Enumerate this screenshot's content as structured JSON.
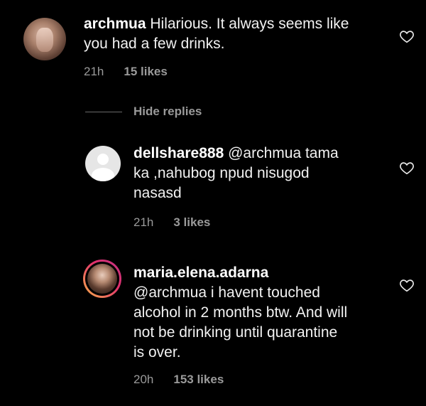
{
  "comments": [
    {
      "username": "archmua",
      "text": " Hilarious. It always seems like",
      "text_line2": "you had a few drinks.",
      "time": "21h",
      "likes": "15 likes"
    },
    {
      "username": "dellshare888",
      "text": " @archmua tama",
      "text_line2": "ka ,nahubog npud nisugod",
      "text_line3": "nasasd",
      "time": "21h",
      "likes": "3 likes"
    },
    {
      "username": "maria.elena.adarna",
      "text_line1": "@archmua i havent touched",
      "text_line2": "alcohol in 2 months btw. And will",
      "text_line3": "not be drinking until quarantine",
      "text_line4": "is over.",
      "time": "20h",
      "likes": "153 likes"
    }
  ],
  "hide_replies_label": "Hide replies",
  "icons": {
    "like": "heart-outline-icon",
    "default_avatar": "person-icon"
  },
  "colors": {
    "background": "#000000",
    "text": "#f2f2f2",
    "meta": "#9a9a9a",
    "story_ring_start": "#f9b34a",
    "story_ring_end": "#c13584"
  }
}
